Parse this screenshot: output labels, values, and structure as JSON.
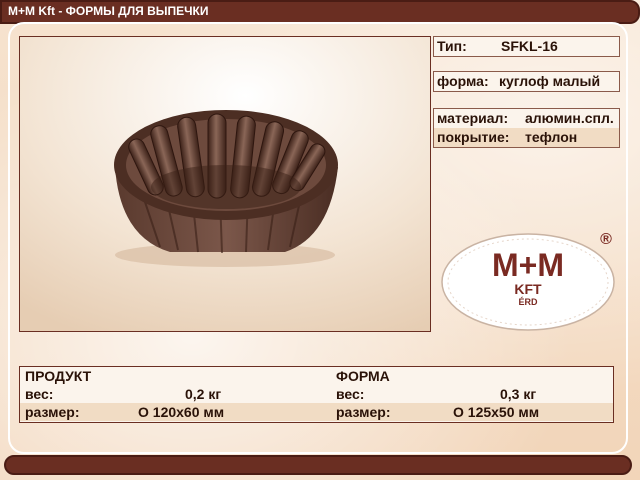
{
  "window": {
    "title": "M+M Kft - ФОРМЫ ДЛЯ ВЫПЕЧКИ"
  },
  "product_info": {
    "type_label": "Тип:",
    "type_value": "SFKL-16",
    "shape_label": "форма:",
    "shape_value": "куглоф малый",
    "material_label": "материал:",
    "material_value": "алюмин.спл.",
    "coating_label": "покрытие:",
    "coating_value": "тефлон"
  },
  "logo": {
    "brand": "M+M",
    "company": "KFT",
    "city": "ÉRD",
    "registered": "®"
  },
  "specs": {
    "product_header": "ПРОДУКТ",
    "form_header": "ФОРМА",
    "weight_label": "вес:",
    "size_label": "размер:",
    "product_weight": "0,2 кг",
    "product_size": "О 120x60 мм",
    "form_weight": "0,3 кг",
    "form_size": "О 125x50 мм"
  },
  "colors": {
    "accent": "#6a2e22",
    "logo_red": "#7a2a22",
    "background": "#f3d9c0"
  }
}
